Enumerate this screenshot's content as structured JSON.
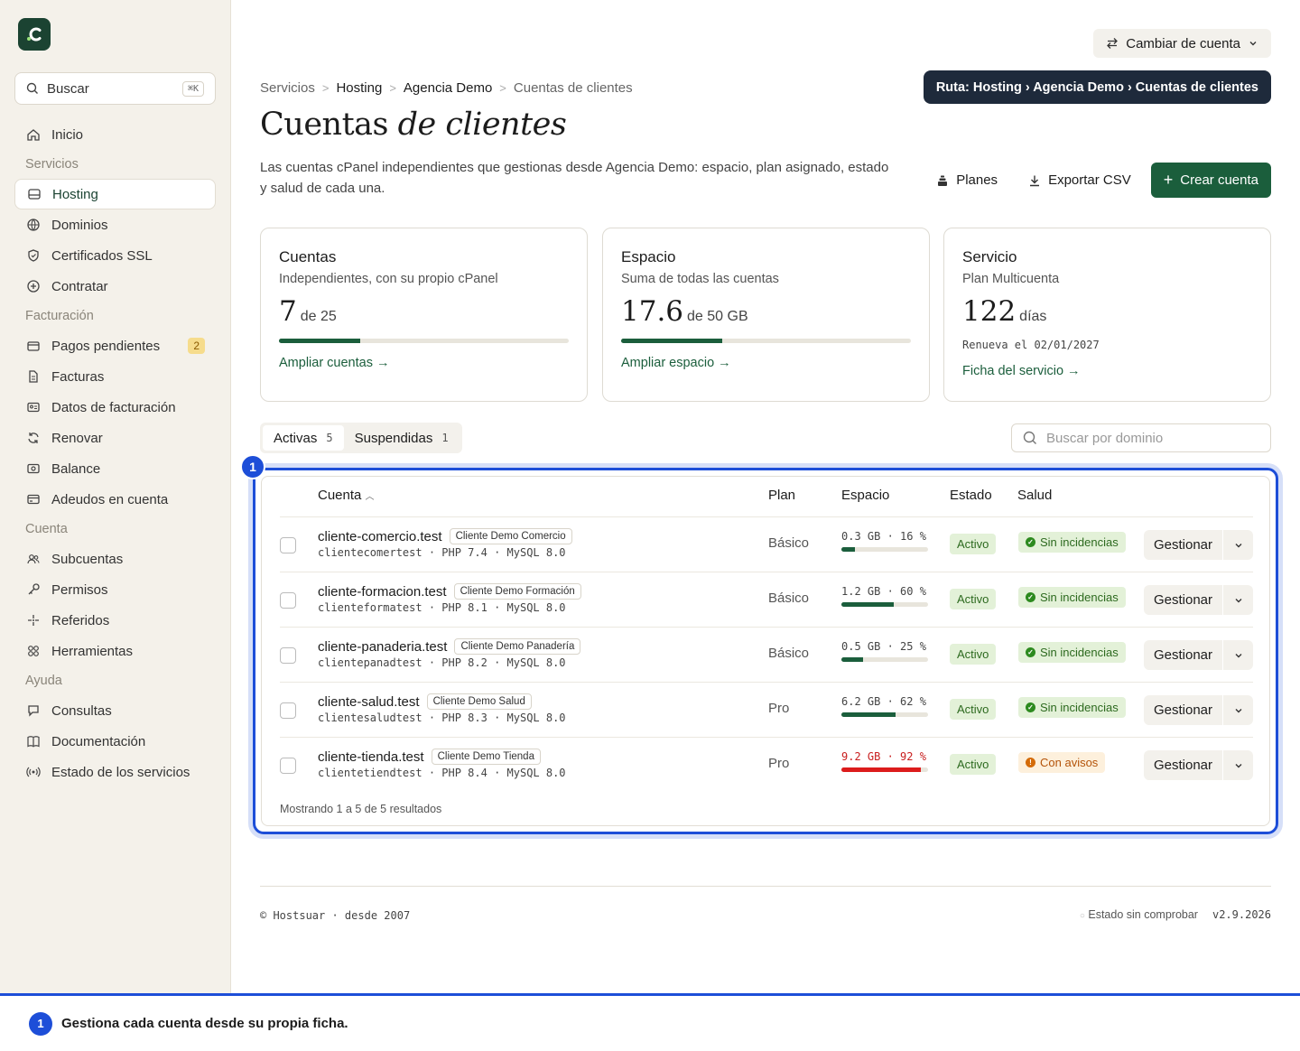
{
  "sidebar": {
    "search_label": "Buscar",
    "search_kbd": "⌘K",
    "items": [
      {
        "type": "item",
        "label": "Inicio",
        "icon": "home-icon"
      },
      {
        "type": "section",
        "label": "Servicios"
      },
      {
        "type": "item",
        "label": "Hosting",
        "icon": "server-icon",
        "active": true
      },
      {
        "type": "item",
        "label": "Dominios",
        "icon": "globe-icon"
      },
      {
        "type": "item",
        "label": "Certificados SSL",
        "icon": "shield-icon"
      },
      {
        "type": "item",
        "label": "Contratar",
        "icon": "plus-circle-icon"
      },
      {
        "type": "section",
        "label": "Facturación"
      },
      {
        "type": "item",
        "label": "Pagos pendientes",
        "icon": "wallet-icon",
        "badge": "2"
      },
      {
        "type": "item",
        "label": "Facturas",
        "icon": "file-icon"
      },
      {
        "type": "item",
        "label": "Datos de facturación",
        "icon": "id-card-icon"
      },
      {
        "type": "item",
        "label": "Renovar",
        "icon": "refresh-icon"
      },
      {
        "type": "item",
        "label": "Balance",
        "icon": "banknote-icon"
      },
      {
        "type": "item",
        "label": "Adeudos en cuenta",
        "icon": "credit-card-icon"
      },
      {
        "type": "section",
        "label": "Cuenta"
      },
      {
        "type": "item",
        "label": "Subcuentas",
        "icon": "users-icon"
      },
      {
        "type": "item",
        "label": "Permisos",
        "icon": "key-icon"
      },
      {
        "type": "item",
        "label": "Referidos",
        "icon": "sparkles-icon"
      },
      {
        "type": "item",
        "label": "Herramientas",
        "icon": "grid-icon"
      },
      {
        "type": "section",
        "label": "Ayuda"
      },
      {
        "type": "item",
        "label": "Consultas",
        "icon": "chat-icon"
      },
      {
        "type": "item",
        "label": "Documentación",
        "icon": "book-icon"
      },
      {
        "type": "item",
        "label": "Estado de los servicios",
        "icon": "broadcast-icon"
      }
    ]
  },
  "header": {
    "switch_account": "Cambiar de cuenta",
    "tooltip": "Ruta: Hosting › Agencia Demo › Cuentas de clientes",
    "breadcrumb": [
      "Servicios",
      "Hosting",
      "Agencia Demo",
      "Cuentas de clientes"
    ],
    "title_plain": "Cuentas",
    "title_italic": "de clientes",
    "description": "Las cuentas cPanel independientes que gestionas desde Agencia Demo: espacio, plan asignado, estado y salud de cada una.",
    "btn_planes": "Planes",
    "btn_export": "Exportar CSV",
    "btn_create": "Crear cuenta"
  },
  "cards": [
    {
      "title": "Cuentas",
      "subtitle": "Independientes, con su propio cPanel",
      "value": "7",
      "unit": "de 25",
      "progress": 0.28,
      "link": "Ampliar cuentas →"
    },
    {
      "title": "Espacio",
      "subtitle": "Suma de todas las cuentas",
      "value": "17.6",
      "unit": "de 50 GB",
      "progress": 0.35,
      "link": "Ampliar espacio →"
    },
    {
      "title": "Servicio",
      "subtitle": "Plan Multicuenta",
      "value": "122",
      "unit": "días",
      "note": "Renueva el 02/01/2027",
      "link": "Ficha del servicio →"
    }
  ],
  "tabs": [
    {
      "label": "Activas",
      "count": "5",
      "active": true
    },
    {
      "label": "Suspendidas",
      "count": "1"
    }
  ],
  "domain_search_placeholder": "Buscar por dominio",
  "table": {
    "columns": [
      "Cuenta",
      "Plan",
      "Espacio",
      "Estado",
      "Salud"
    ],
    "rows": [
      {
        "domain": "cliente-comercio.test",
        "client": "Cliente Demo Comercio",
        "meta": "clientecomertest · PHP 7.4 · MySQL 8.0",
        "plan": "Básico",
        "space": "0.3 GB · 16 %",
        "pct": 0.16,
        "status": "Activo",
        "health": "Sin incidencias",
        "health_ok": true,
        "action": "Gestionar"
      },
      {
        "domain": "cliente-formacion.test",
        "client": "Cliente Demo Formación",
        "meta": "clienteformatest · PHP 8.1 · MySQL 8.0",
        "plan": "Básico",
        "space": "1.2 GB · 60 %",
        "pct": 0.6,
        "status": "Activo",
        "health": "Sin incidencias",
        "health_ok": true,
        "action": "Gestionar"
      },
      {
        "domain": "cliente-panaderia.test",
        "client": "Cliente Demo Panadería",
        "meta": "clientepanadtest · PHP 8.2 · MySQL 8.0",
        "plan": "Básico",
        "space": "0.5 GB · 25 %",
        "pct": 0.25,
        "status": "Activo",
        "health": "Sin incidencias",
        "health_ok": true,
        "action": "Gestionar"
      },
      {
        "domain": "cliente-salud.test",
        "client": "Cliente Demo Salud",
        "meta": "clientesaludtest · PHP 8.3 · MySQL 8.0",
        "plan": "Pro",
        "space": "6.2 GB · 62 %",
        "pct": 0.62,
        "status": "Activo",
        "health": "Sin incidencias",
        "health_ok": true,
        "action": "Gestionar"
      },
      {
        "domain": "cliente-tienda.test",
        "client": "Cliente Demo Tienda",
        "meta": "clientetiendtest · PHP 8.4 · MySQL 8.0",
        "plan": "Pro",
        "space": "9.2 GB · 92 %",
        "pct": 0.92,
        "status": "Activo",
        "health": "Con avisos",
        "health_ok": false,
        "warn": true,
        "action": "Gestionar"
      }
    ],
    "showing": "Mostrando 1 a 5 de 5 resultados"
  },
  "footer": {
    "left": "© Hostsuar · desde 2007",
    "status": "Estado sin comprobar",
    "version": "v2.9.2026"
  },
  "callout": {
    "number": "1",
    "text": "Gestiona cada cuenta desde su propia ficha."
  },
  "colors": {
    "brand": "#1b5e3c",
    "accent": "#1d4ed8",
    "warn": "#dc1c1c"
  }
}
